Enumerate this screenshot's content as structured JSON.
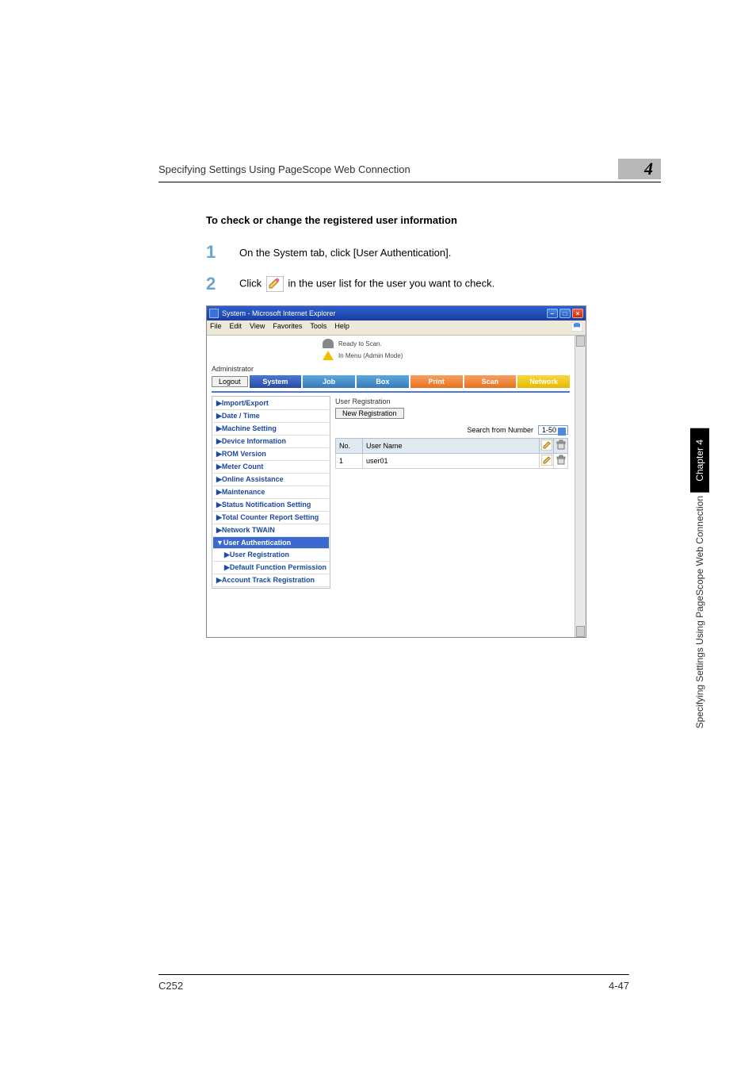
{
  "header": {
    "title": "Specifying Settings Using PageScope Web Connection",
    "chapter_num": "4"
  },
  "section": {
    "heading": "To check or change the registered user information"
  },
  "steps": {
    "s1_num": "1",
    "s1_text": "On the System tab, click [User Authentication].",
    "s2_num": "2",
    "s2_a": "Click ",
    "s2_b": " in the user list for the user you want to check."
  },
  "browser": {
    "title": "System - Microsoft Internet Explorer",
    "menus": {
      "file": "File",
      "edit": "Edit",
      "view": "View",
      "favorites": "Favorites",
      "tools": "Tools",
      "help": "Help"
    },
    "status_ready": "Ready to Scan.",
    "status_mode": "In Menu (Admin Mode)",
    "admin_label": "Administrator",
    "logout": "Logout",
    "tabs": {
      "system": "System",
      "job": "Job",
      "box": "Box",
      "print": "Print",
      "scan": "Scan",
      "network": "Network"
    },
    "sidebar": {
      "items": [
        {
          "label": "▶Import/Export"
        },
        {
          "label": "▶Date / Time"
        },
        {
          "label": "▶Machine Setting"
        },
        {
          "label": "▶Device Information"
        },
        {
          "label": "▶ROM Version"
        },
        {
          "label": "▶Meter Count"
        },
        {
          "label": "▶Online Assistance"
        },
        {
          "label": "▶Maintenance"
        },
        {
          "label": "▶Status Notification Setting"
        },
        {
          "label": "▶Total Counter Report Setting"
        },
        {
          "label": "▶Network TWAIN"
        },
        {
          "label": "▼User Authentication"
        },
        {
          "label": "▶User Registration"
        },
        {
          "label": "▶Default Function Permission"
        },
        {
          "label": "▶Account Track Registration"
        }
      ]
    },
    "right": {
      "title": "User Registration",
      "new_reg": "New Registration",
      "search_label": "Search from Number",
      "search_value": "1-50",
      "col_no": "No.",
      "col_user": "User Name",
      "rows": [
        {
          "no": "",
          "name": ""
        },
        {
          "no": "1",
          "name": "user01"
        }
      ]
    }
  },
  "side_tab": {
    "chapter": "Chapter 4",
    "text": "Specifying Settings Using PageScope Web Connection"
  },
  "footer": {
    "left": "C252",
    "right": "4-47"
  },
  "icons": {
    "edit": "edit-pencil-icon",
    "delete": "trash-icon"
  }
}
